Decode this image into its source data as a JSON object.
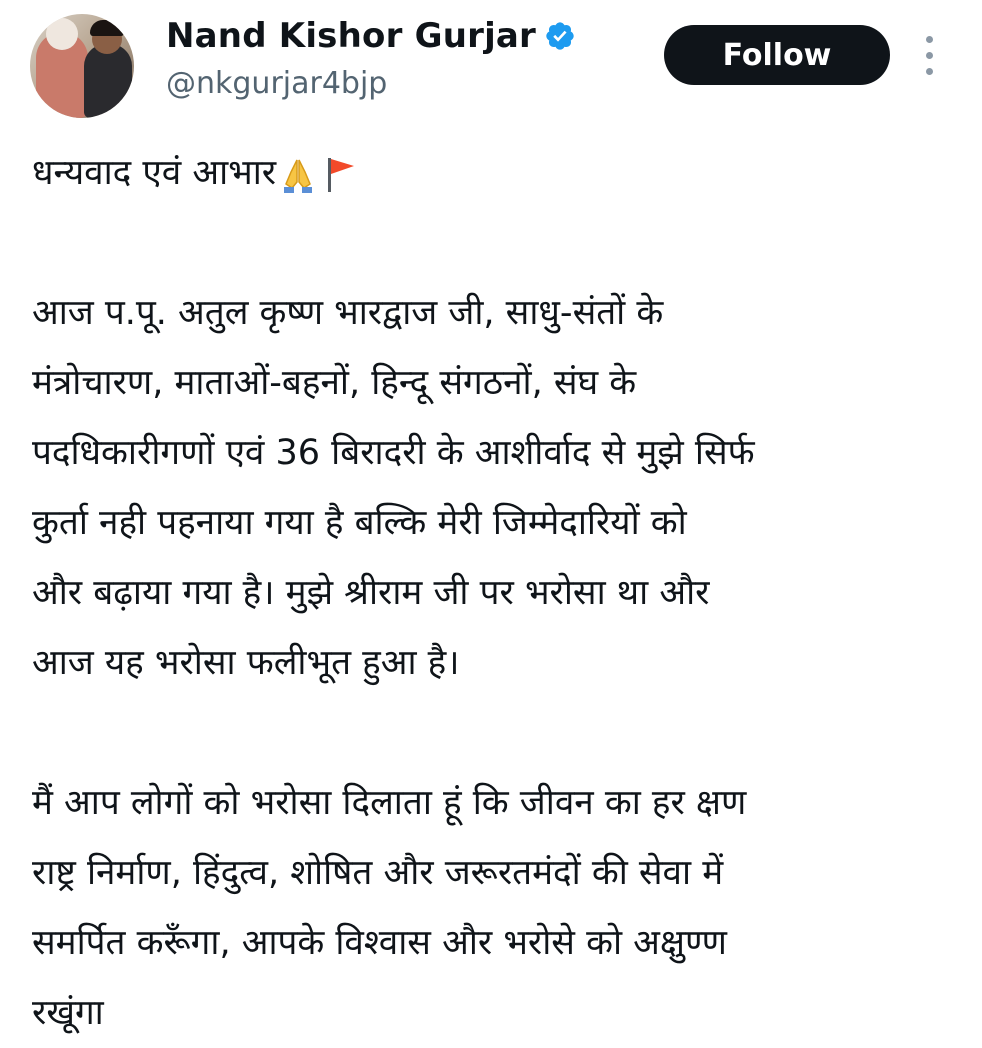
{
  "author": {
    "name": "Nand Kishor Gurjar",
    "handle": "@nkgurjar4bjp",
    "verified_color": "#1d9bf0"
  },
  "actions": {
    "follow_label": "Follow",
    "more_icon": "more-vertical-icon"
  },
  "tweet": {
    "line1": "धन्यवाद एवं आभार",
    "line1_emojis": [
      "folded-hands-icon",
      "flag-icon"
    ],
    "paragraph2": [
      "आज प.पू. अतुल कृष्ण भारद्वाज जी, साधु-संतों के",
      "मंत्रोचारण, माताओं-बहनों, हिन्दू संगठनों, संघ के",
      "पदधिकारीगणों एवं 36 बिरादरी के आशीर्वाद से मुझे सिर्फ",
      "कुर्ता नही  पहनाया गया है बल्कि मेरी जिम्मेदारियों को",
      "और बढ़ाया गया है। मुझे श्रीराम जी पर भरोसा था और",
      "आज यह भरोसा फलीभूत हुआ है।"
    ],
    "paragraph3": [
      "मैं आप लोगों को भरोसा दिलाता हूं कि जीवन का हर क्षण",
      "राष्ट्र निर्माण, हिंदुत्व, शोषित और जरूरतमंदों की सेवा में",
      "समर्पित करूँगा, आपके विश्वास और भरोसे को अक्षुण्ण",
      "रखूंगा"
    ]
  }
}
